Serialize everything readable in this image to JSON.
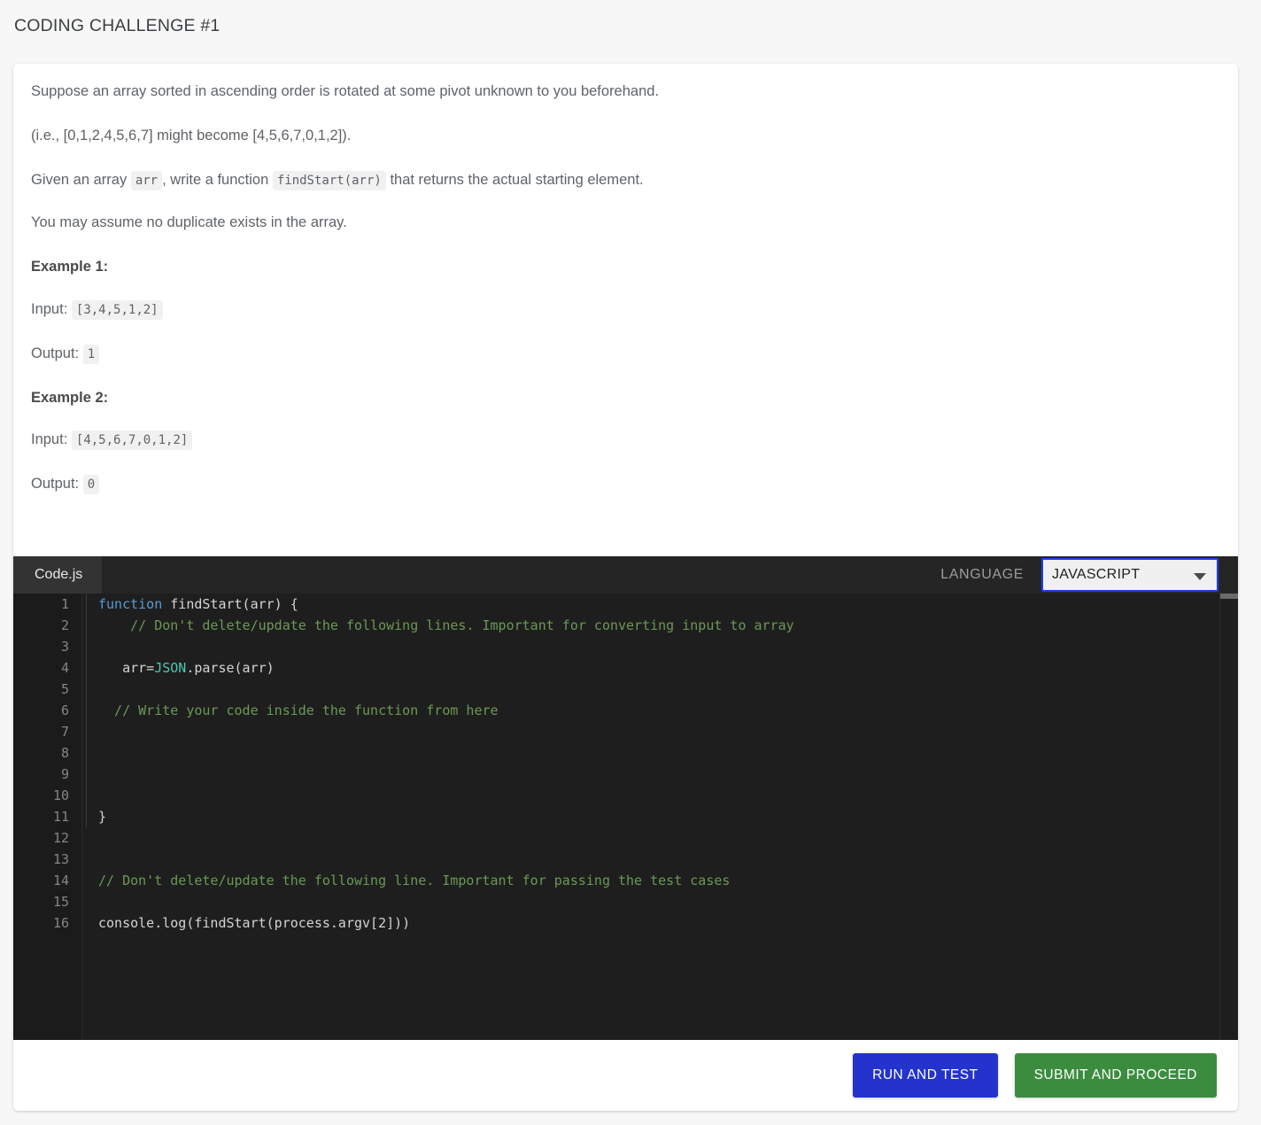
{
  "header": {
    "title": "CODING CHALLENGE #1"
  },
  "problem": {
    "paragraphs": [
      "Suppose an array sorted in ascending order is rotated at some pivot unknown to you beforehand.",
      "(i.e., [0,1,2,4,5,6,7] might become [4,5,6,7,0,1,2])."
    ],
    "given_prefix": "Given an array",
    "given_code_1": "arr",
    "given_mid": ", write a function",
    "given_code_2": "findStart(arr)",
    "given_suffix": "that returns the actual starting element.",
    "no_duplicates": "You may assume no duplicate exists in the array.",
    "examples": [
      {
        "heading": "Example 1:",
        "input_label": "Input:",
        "input_value": "[3,4,5,1,2]",
        "output_label": "Output:",
        "output_value": "1"
      },
      {
        "heading": "Example 2:",
        "input_label": "Input:",
        "input_value": "[4,5,6,7,0,1,2]",
        "output_label": "Output:",
        "output_value": "0"
      }
    ]
  },
  "editor": {
    "file_tab": "Code.js",
    "language_label": "LANGUAGE",
    "language_value": "JAVASCRIPT",
    "language_options": [
      "JAVASCRIPT"
    ],
    "line_numbers": [
      "1",
      "2",
      "3",
      "4",
      "5",
      "6",
      "7",
      "8",
      "9",
      "10",
      "11",
      "12",
      "13",
      "14",
      "15",
      "16"
    ],
    "lines": [
      {
        "segments": [
          {
            "t": "function ",
            "c": "kw"
          },
          {
            "t": "findStart(arr) {",
            "c": ""
          }
        ]
      },
      {
        "segments": [
          {
            "t": "    // Don't delete/update the following lines. Important for converting input to array",
            "c": "cmt"
          }
        ]
      },
      {
        "segments": [
          {
            "t": "",
            "c": ""
          }
        ]
      },
      {
        "segments": [
          {
            "t": "   arr=",
            "c": ""
          },
          {
            "t": "JSON",
            "c": "cls"
          },
          {
            "t": ".parse(arr)",
            "c": ""
          }
        ]
      },
      {
        "segments": [
          {
            "t": "",
            "c": ""
          }
        ]
      },
      {
        "segments": [
          {
            "t": "  // Write your code inside the function from here",
            "c": "cmt"
          }
        ]
      },
      {
        "segments": [
          {
            "t": "",
            "c": ""
          }
        ]
      },
      {
        "segments": [
          {
            "t": "",
            "c": ""
          }
        ]
      },
      {
        "segments": [
          {
            "t": "",
            "c": ""
          }
        ]
      },
      {
        "segments": [
          {
            "t": "",
            "c": ""
          }
        ]
      },
      {
        "segments": [
          {
            "t": "}",
            "c": ""
          }
        ]
      },
      {
        "segments": [
          {
            "t": "",
            "c": ""
          }
        ]
      },
      {
        "segments": [
          {
            "t": "",
            "c": ""
          }
        ]
      },
      {
        "segments": [
          {
            "t": "// Don't delete/update the following line. Important for passing the test cases",
            "c": "cmt"
          }
        ]
      },
      {
        "segments": [
          {
            "t": "",
            "c": ""
          }
        ]
      },
      {
        "segments": [
          {
            "t": "console.log(findStart(process.argv[2]))",
            "c": ""
          }
        ]
      }
    ]
  },
  "footer": {
    "run_label": "RUN AND TEST",
    "submit_label": "SUBMIT AND PROCEED"
  },
  "colors": {
    "page_background": "#f7f7f7",
    "card_background": "#ffffff",
    "editor_background": "#1e1e1e",
    "editor_header": "#252526",
    "run_button": "#2333cc",
    "submit_button": "#3b8c3f",
    "select_focus_ring": "#1a3ff0",
    "keyword": "#569cd6",
    "class_name": "#4ec9b0",
    "comment": "#6a9955",
    "code_text": "#d4d4d4"
  }
}
